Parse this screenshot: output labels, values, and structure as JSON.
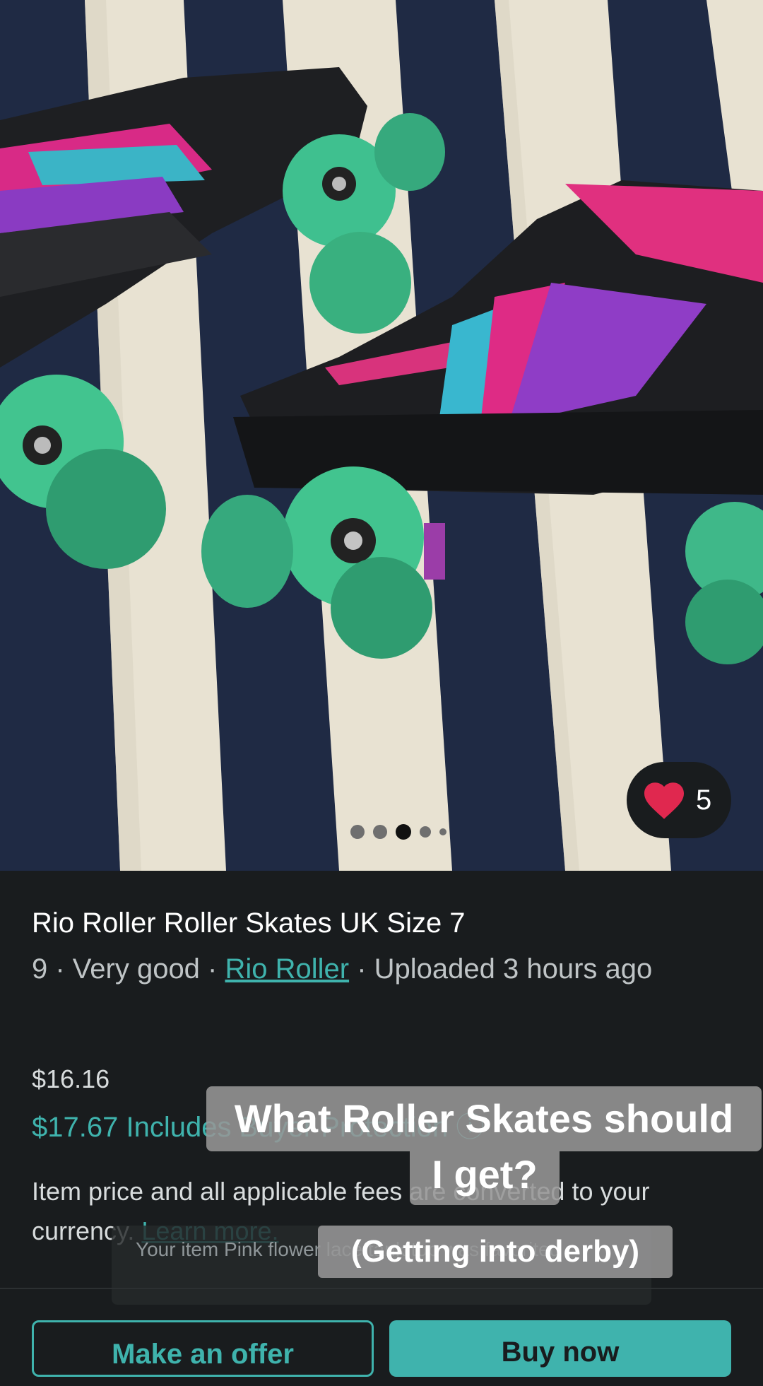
{
  "listing": {
    "favorites_count": "5",
    "title": "Rio Roller Roller Skates UK Size 7",
    "meta_prefix": "9 · Very good · ",
    "brand": "Rio Roller",
    "meta_suffix": " · Uploaded 3 hours ago",
    "price_original": "$16.16",
    "price_total": "$17.67 Includes Buyer Protection ⓘ",
    "fees_text": "Item price and all applicable fees are converted to your currency.",
    "learn_more": "Learn more."
  },
  "carousel": {
    "count": 5,
    "active_index": 2
  },
  "toast": {
    "text": "Your item Pink flower lace tank top was favorited"
  },
  "captions": {
    "line1": "What Roller Skates should",
    "line2": "I get?",
    "line3": "(Getting into derby)"
  },
  "actions": {
    "make_offer": "Make an offer",
    "buy": "Buy now"
  },
  "colors": {
    "accent": "#3fb3ad",
    "background": "#191c1e",
    "heart": "#e0284f"
  }
}
